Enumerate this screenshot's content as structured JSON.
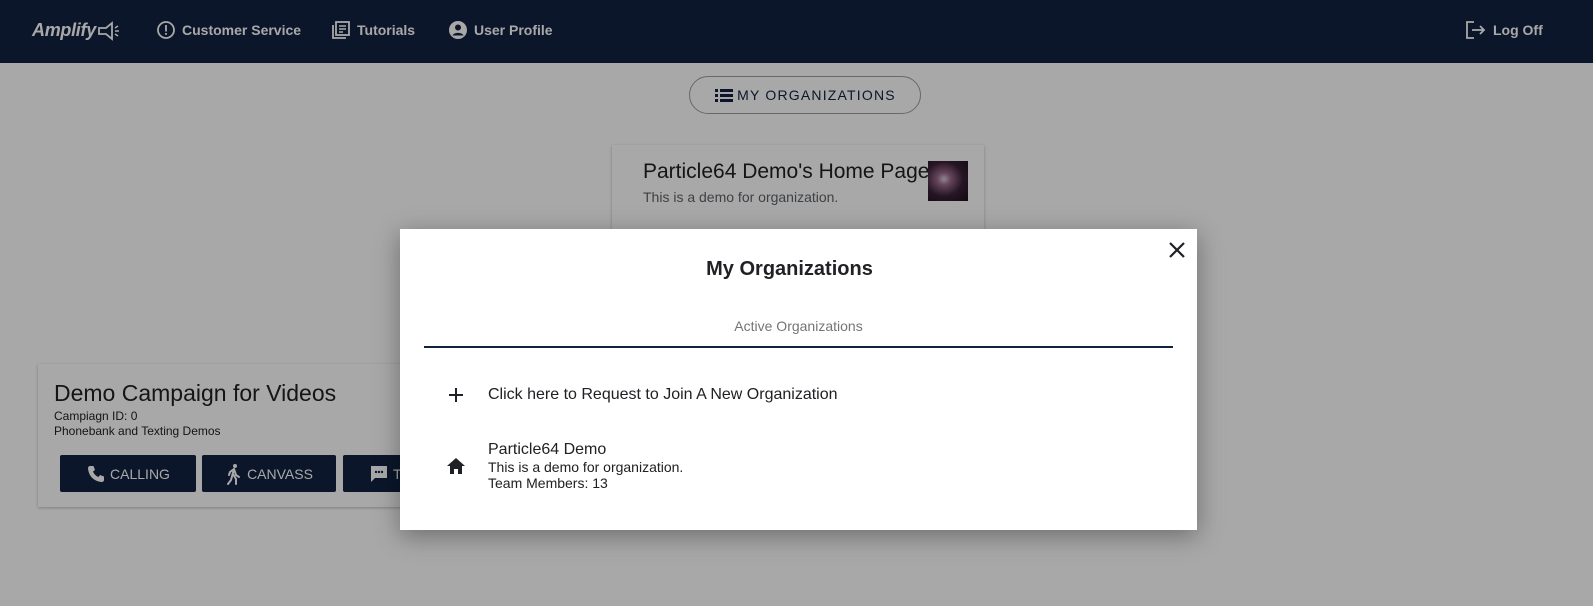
{
  "app": {
    "logo_text": "Amplify"
  },
  "nav": {
    "customer_service": "Customer Service",
    "tutorials": "Tutorials",
    "user_profile": "User Profile",
    "log_off": "Log Off"
  },
  "subheader": {
    "my_orgs_button": "MY ORGANIZATIONS"
  },
  "home_card": {
    "title": "Particle64 Demo's Home Page",
    "subtitle": "This is a demo for organization."
  },
  "campaign_card": {
    "title": "Demo Campaign for Videos",
    "campaign_id": "Campiagn ID: 0",
    "description": "Phonebank and Texting Demos",
    "buttons": {
      "calling": "CALLING",
      "canvass": "CANVASS",
      "text": "T"
    }
  },
  "modal": {
    "title": "My Organizations",
    "tab": "Active Organizations",
    "join_item": "Click here to Request to Join A New Organization",
    "orgs": [
      {
        "name": "Particle64 Demo",
        "description": "This is a demo for organization.",
        "members": "Team Members: 13"
      }
    ]
  },
  "colors": {
    "navy": "#112240",
    "overlay": "rgba(0,0,0,0.34)"
  }
}
